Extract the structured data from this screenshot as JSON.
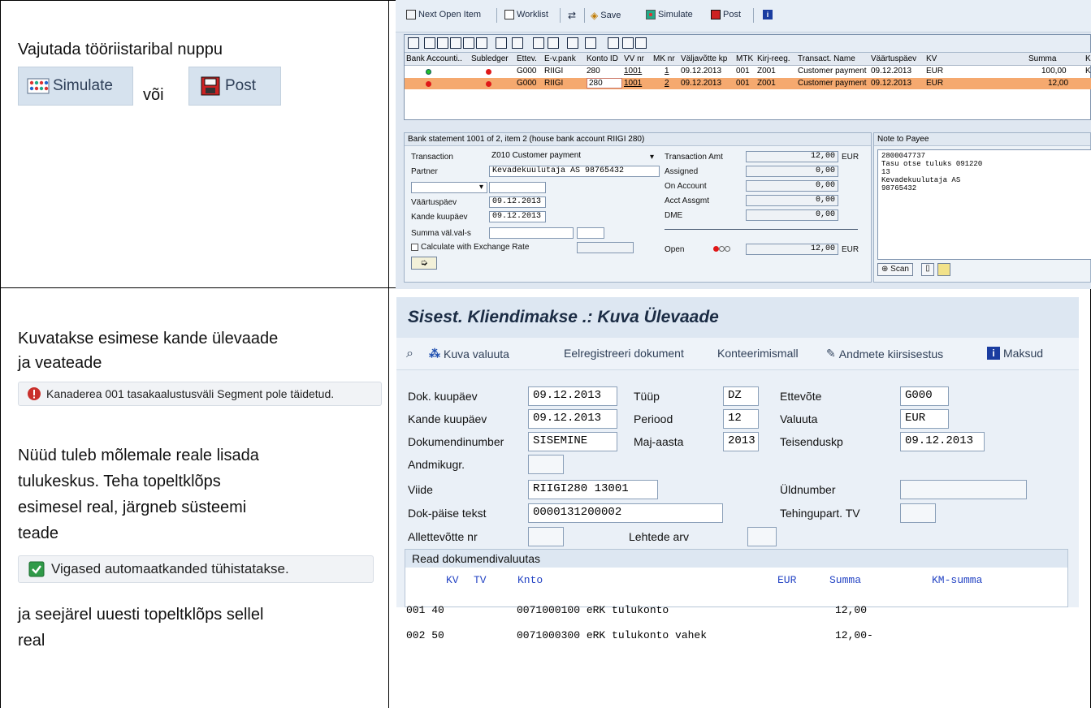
{
  "left": {
    "text1": "Vajutada tööriistaribal nuppu",
    "badge_simulate": "Simulate",
    "or_text": "või",
    "badge_post": "Post",
    "text2_line1": "Kuvatakse esimese kande ülevaade",
    "text2_line2": "ja veateade",
    "error_message": "Kanaderea 001 tasakaalustusväli Segment pole täidetud.",
    "text3_line1": "Nüüd tuleb mõlemale reale lisada",
    "text3_line2": "tulukeskus. Teha topeltklõps",
    "text3_line3": "esimesel real, järgneb süsteemi",
    "text3_line4": "teade",
    "success_message": "Vigased automaatkanded tühistatakse.",
    "text4_line1": " ja seejärel uuesti topeltklõps sellel",
    "text4_line2": "real"
  },
  "sap1": {
    "toolbar": {
      "next_open_item": "Next Open Item",
      "worklist": "Worklist",
      "save": "Save",
      "simulate": "Simulate",
      "post": "Post"
    },
    "columns": [
      "Bank Accounti..",
      "Subledger",
      "Ettev.",
      "E-v.pank",
      "Konto ID",
      "VV nr",
      "MK nr",
      "Väljavõtte kp",
      "MTK",
      "Kirj-reeg.",
      "Transact. Name",
      "Väärtuspäev",
      "KV",
      "Summa",
      "K"
    ],
    "rows": [
      {
        "bank_status": "green",
        "subledger_status": "red",
        "ettev": "G000",
        "evpank": "RIIGI",
        "konto_id": "280",
        "vv_nr": "1001",
        "mk_nr": "1",
        "date": "09.12.2013",
        "mtk": "001",
        "kirj": "Z001",
        "name": "Customer payment",
        "value_date": "09.12.2013",
        "kv": "EUR",
        "summa": "100,00",
        "k": "K"
      },
      {
        "bank_status": "red",
        "subledger_status": "red",
        "ettev": "G000",
        "evpank": "RIIGI",
        "konto_id": "280",
        "vv_nr": "1001",
        "mk_nr": "2",
        "date": "09.12.2013",
        "mtk": "001",
        "kirj": "Z001",
        "name": "Customer payment",
        "value_date": "09.12.2013",
        "kv": "EUR",
        "summa": "12,00",
        "k": ""
      }
    ],
    "detail_title": "Bank statement 1001 of 2, item 2 (house bank account RIIGI 280)",
    "transaction_label": "Transaction",
    "transaction_value": "Z010 Customer payment",
    "partner_label": "Partner",
    "partner_value": "Kevadekuulutaja AS 98765432",
    "vaartuspaev_label": "Väärtuspäev",
    "vaartuspaev_value": "09.12.2013",
    "kande_label": "Kande kuupäev",
    "kande_value": "09.12.2013",
    "summa_valval_label": "Summa väl.val-s",
    "calc_label": "Calculate with Exchange Rate",
    "amt_label": "Transaction Amt",
    "amt_value": "12,00",
    "amt_cur": "EUR",
    "assigned_label": "Assigned",
    "assigned_value": "0,00",
    "onaccount_label": "On Account",
    "onaccount_value": "0,00",
    "acct_label": "Acct Assgmt",
    "acct_value": "0,00",
    "dme_label": "DME",
    "dme_value": "0,00",
    "open_label": "Open",
    "open_value": "12,00",
    "open_cur": "EUR",
    "note_title": "Note to Payee",
    "note_lines": [
      "2800047737",
      "Tasu otse tuluks 091220",
      "13",
      "Kevadekuulutaja AS",
      "98765432"
    ],
    "scan_label": "Scan"
  },
  "sap2": {
    "title": "Sisest. Kliendimakse .: Kuva Ülevaade",
    "toolbar": {
      "kuva_valuuta": "Kuva valuuta",
      "eelregistreeri": "Eelregistreeri dokument",
      "konteerimismall": "Konteerimismall",
      "andmete": "Andmete kiirsisestus",
      "maksud": "Maksud"
    },
    "fields": {
      "dok_kuupaev_label": "Dok. kuupäev",
      "dok_kuupaev": "09.12.2013",
      "tuup_label": "Tüüp",
      "tuup": "DZ",
      "ettevote_label": "Ettevõte",
      "ettevote": "G000",
      "kande_label": "Kande kuupäev",
      "kande": "09.12.2013",
      "periood_label": "Periood",
      "periood": "12",
      "valuuta_label": "Valuuta",
      "valuuta": "EUR",
      "dokumendinumber_label": "Dokumendinumber",
      "dokumendinumber": "SISEMINE",
      "majaasta_label": "Maj-aasta",
      "majaasta": "2013",
      "teisenduskp_label": "Teisenduskp",
      "teisenduskp": "09.12.2013",
      "andmikugr_label": "Andmikugr.",
      "viide_label": "Viide",
      "viide": "RIIGI280  13001",
      "uldnumber_label": "Üldnumber",
      "dokpaise_label": "Dok-päise tekst",
      "dokpaise": "0000131200002",
      "tehingupart_label": "Tehingupart. TV",
      "allettevotte_label": "Allettevõtte nr",
      "lehtede_label": "Lehtede arv"
    },
    "lines_title": "Read dokumendivaluutas",
    "lines_header": {
      "kv": "KV",
      "tv": "TV",
      "knto": "Knto",
      "eur": "EUR",
      "summa": "Summa",
      "km": "KM-summa"
    },
    "lines": [
      {
        "pos": "001 40",
        "account": "0071000100 eRK tulukonto",
        "amount": "12,00"
      },
      {
        "pos": "002 50",
        "account": "0071000300 eRK tulukonto vahek",
        "amount": "12,00-"
      }
    ]
  }
}
